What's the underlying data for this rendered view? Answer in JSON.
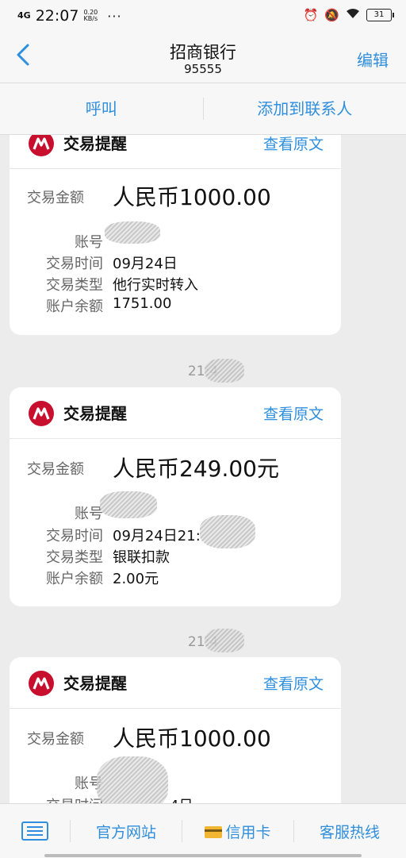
{
  "status": {
    "network": "4G",
    "time": "22:07",
    "speed_value": "0.20",
    "speed_unit": "KB/s",
    "more": "···",
    "battery": "31"
  },
  "header": {
    "back": "<",
    "title": "招商银行",
    "number": "95555",
    "edit": "编辑"
  },
  "actions": {
    "call": "呼叫",
    "add_contact": "添加到联系人"
  },
  "labels": {
    "card_title": "交易提醒",
    "view_original": "查看原文",
    "amount": "交易金额",
    "account": "账号",
    "time": "交易时间",
    "type": "交易类型",
    "balance": "账户余额"
  },
  "messages": [
    {
      "amount": "人民币1000.00",
      "time": "09月24日",
      "type": "他行实时转入",
      "balance": "1751.00"
    },
    {
      "timestamp": "21:4",
      "amount": "人民币249.00元",
      "time": "09月24日21:",
      "type": "银联扣款",
      "balance": "2.00元"
    },
    {
      "timestamp": "21:4",
      "amount": "人民币1000.00",
      "time": "4日"
    }
  ],
  "tabbar": {
    "website": "官方网站",
    "credit_card": "信用卡",
    "hotline": "客服热线"
  },
  "colors": {
    "accent": "#2f8fde",
    "logo_red": "#c8102e"
  }
}
